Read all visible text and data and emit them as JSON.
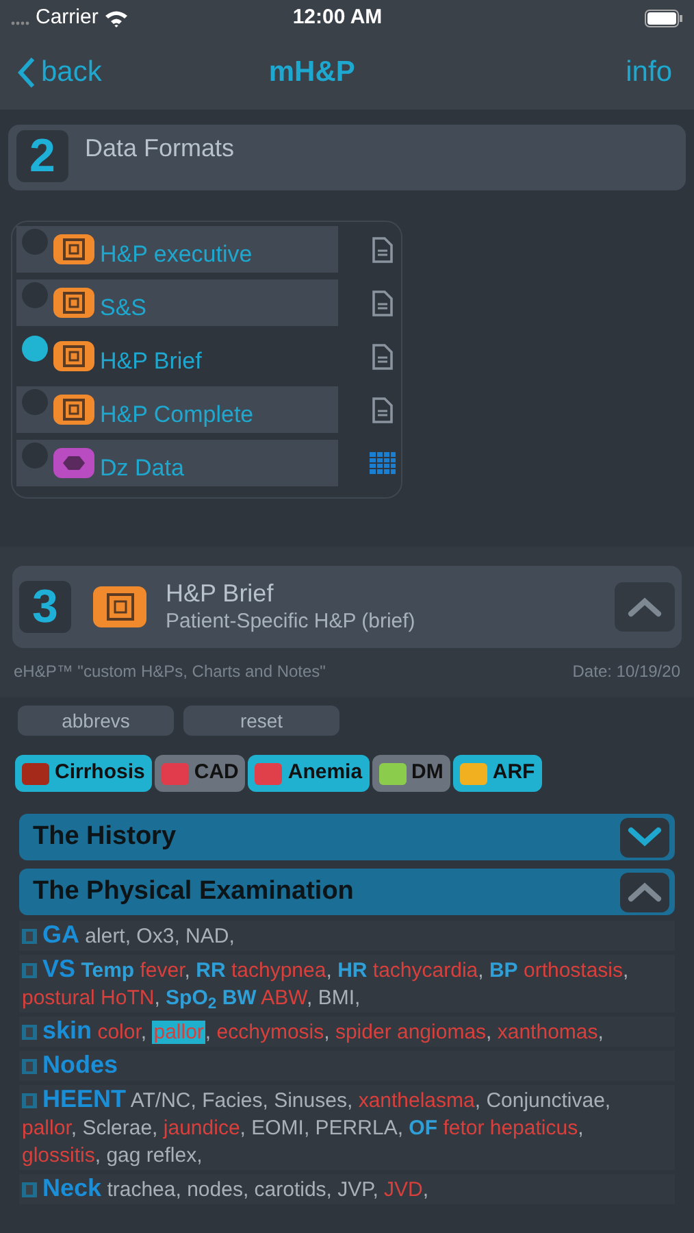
{
  "status_bar": {
    "carrier": "Carrier",
    "time": "12:00 AM"
  },
  "nav": {
    "back": "back",
    "title": "mH&P",
    "info": "info"
  },
  "section2": {
    "number": "2",
    "title": "Data Formats"
  },
  "formats": [
    {
      "label": "H&P executive",
      "selected": false,
      "kind": "form"
    },
    {
      "label": "S&S",
      "selected": false,
      "kind": "form"
    },
    {
      "label": "H&P Brief",
      "selected": true,
      "kind": "form"
    },
    {
      "label": "H&P Complete",
      "selected": false,
      "kind": "form"
    },
    {
      "label": "Dz Data",
      "selected": false,
      "kind": "data"
    }
  ],
  "section3": {
    "number": "3",
    "title": "H&P Brief",
    "subtitle": "Patient-Specific H&P (brief)",
    "expanded": true
  },
  "footer": {
    "left": "eH&P™ \"custom H&Ps, Charts and Notes\"",
    "right": "Date: 10/19/20"
  },
  "buttons": [
    "abbrevs",
    "reset"
  ],
  "tags": [
    {
      "label": "Cirrhosis",
      "selected": true,
      "color": "#a52a1a"
    },
    {
      "label": "CAD",
      "selected": false,
      "color": "#e03c4c"
    },
    {
      "label": "Anemia",
      "selected": true,
      "color": "#e0404a"
    },
    {
      "label": "DM",
      "selected": false,
      "color": "#8ccc4c"
    },
    {
      "label": "ARF",
      "selected": true,
      "color": "#f0b020"
    }
  ],
  "accordions": [
    {
      "title": "The History",
      "expanded": false
    },
    {
      "title": "The Physical Examination",
      "expanded": true
    }
  ],
  "exam": [
    {
      "label": "GA",
      "tokens": [
        {
          "text": "alert, Ox3, NAD,",
          "kind": "plain"
        }
      ]
    },
    {
      "label": "VS",
      "tokens": [
        {
          "text": "Temp",
          "kind": "sub"
        },
        {
          "text": "fever",
          "kind": "finding"
        },
        {
          "text": ",",
          "kind": "plain"
        },
        {
          "text": "RR",
          "kind": "sub"
        },
        {
          "text": "tachypnea",
          "kind": "finding"
        },
        {
          "text": ",",
          "kind": "plain"
        },
        {
          "text": "HR",
          "kind": "sub"
        },
        {
          "text": "tachycardia",
          "kind": "finding"
        },
        {
          "text": ",",
          "kind": "plain"
        },
        {
          "text": "BP",
          "kind": "sub"
        },
        {
          "text": "orthostasis",
          "kind": "finding"
        },
        {
          "text": ",",
          "kind": "plain"
        },
        {
          "text": "postural HoTN",
          "kind": "finding"
        },
        {
          "text": ",",
          "kind": "plain"
        },
        {
          "text": "SpO$_{2}$",
          "kind": "sub"
        },
        {
          "text": "BW",
          "kind": "sub"
        },
        {
          "text": "ABW",
          "kind": "finding"
        },
        {
          "text": ", BMI,",
          "kind": "plain"
        }
      ]
    },
    {
      "label": "skin",
      "tokens": [
        {
          "text": "color",
          "kind": "finding"
        },
        {
          "text": ",",
          "kind": "plain"
        },
        {
          "text": "pallor",
          "kind": "highlight"
        },
        {
          "text": ",",
          "kind": "plain"
        },
        {
          "text": "ecchymosis",
          "kind": "finding"
        },
        {
          "text": ",",
          "kind": "plain"
        },
        {
          "text": "spider angiomas",
          "kind": "finding"
        },
        {
          "text": ",",
          "kind": "plain"
        },
        {
          "text": "xanthomas",
          "kind": "finding"
        },
        {
          "text": ",",
          "kind": "plain"
        }
      ]
    },
    {
      "label": "Nodes"
    },
    {
      "label": "HEENT",
      "tokens": [
        {
          "text": "AT/NC, Facies, Sinuses,",
          "kind": "plain"
        },
        {
          "text": "xanthelasma",
          "kind": "finding"
        },
        {
          "text": ", Conjunctivae,",
          "kind": "plain"
        },
        {
          "text": "pallor",
          "kind": "finding"
        },
        {
          "text": ", Sclerae,",
          "kind": "plain"
        },
        {
          "text": "jaundice",
          "kind": "finding"
        },
        {
          "text": ", EOMI, PERRLA,",
          "kind": "plain"
        },
        {
          "text": "OF",
          "kind": "sub"
        },
        {
          "text": "fetor hepaticus",
          "kind": "finding"
        },
        {
          "text": ",",
          "kind": "plain"
        },
        {
          "text": "glossitis",
          "kind": "finding"
        },
        {
          "text": ", gag reflex,",
          "kind": "plain"
        }
      ]
    },
    {
      "label": "Neck",
      "tokens": [
        {
          "text": "trachea, nodes, carotids, JVP,",
          "kind": "plain"
        },
        {
          "text": "JVD",
          "kind": "finding"
        },
        {
          "text": ",",
          "kind": "plain"
        }
      ]
    }
  ]
}
